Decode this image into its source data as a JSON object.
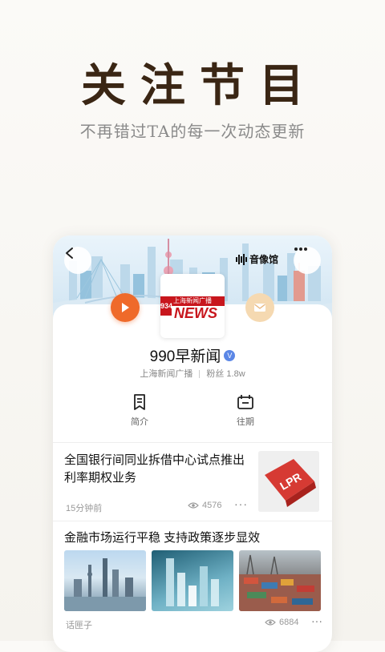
{
  "hero": {
    "title": "关注节目",
    "subtitle": "不再错过TA的每一次动态更新"
  },
  "header": {
    "audio_label": "音像馆"
  },
  "channel": {
    "name": "990早新闻",
    "verified_badge": "V",
    "org": "上海新闻广播",
    "fans": "粉丝 1.8w",
    "logo_number": "934",
    "logo_text": "上海新闻广播",
    "logo_word": "NEWS"
  },
  "tabs": [
    {
      "label": "简介"
    },
    {
      "label": "往期"
    }
  ],
  "articles": [
    {
      "title": "全国银行间同业拆借中心试点推出利率期权业务",
      "time": "15分钟前",
      "views": "4576",
      "thumb_text": "LPR"
    },
    {
      "title": "金融市场运行平稳 支持政策逐步显效",
      "source": "话匣子",
      "views": "6884"
    }
  ],
  "colors": {
    "title_brown": "#3a2614",
    "play_orange": "#ef6a2a",
    "mail_peach": "#f5d9b1",
    "verified_blue": "#5b87e6",
    "logo_red": "#c8161d"
  },
  "icons": [
    "back-arrow-icon",
    "audio-bars-icon",
    "more-dots-icon",
    "play-icon",
    "mail-icon",
    "intro-doc-icon",
    "archive-box-icon",
    "eye-icon"
  ]
}
